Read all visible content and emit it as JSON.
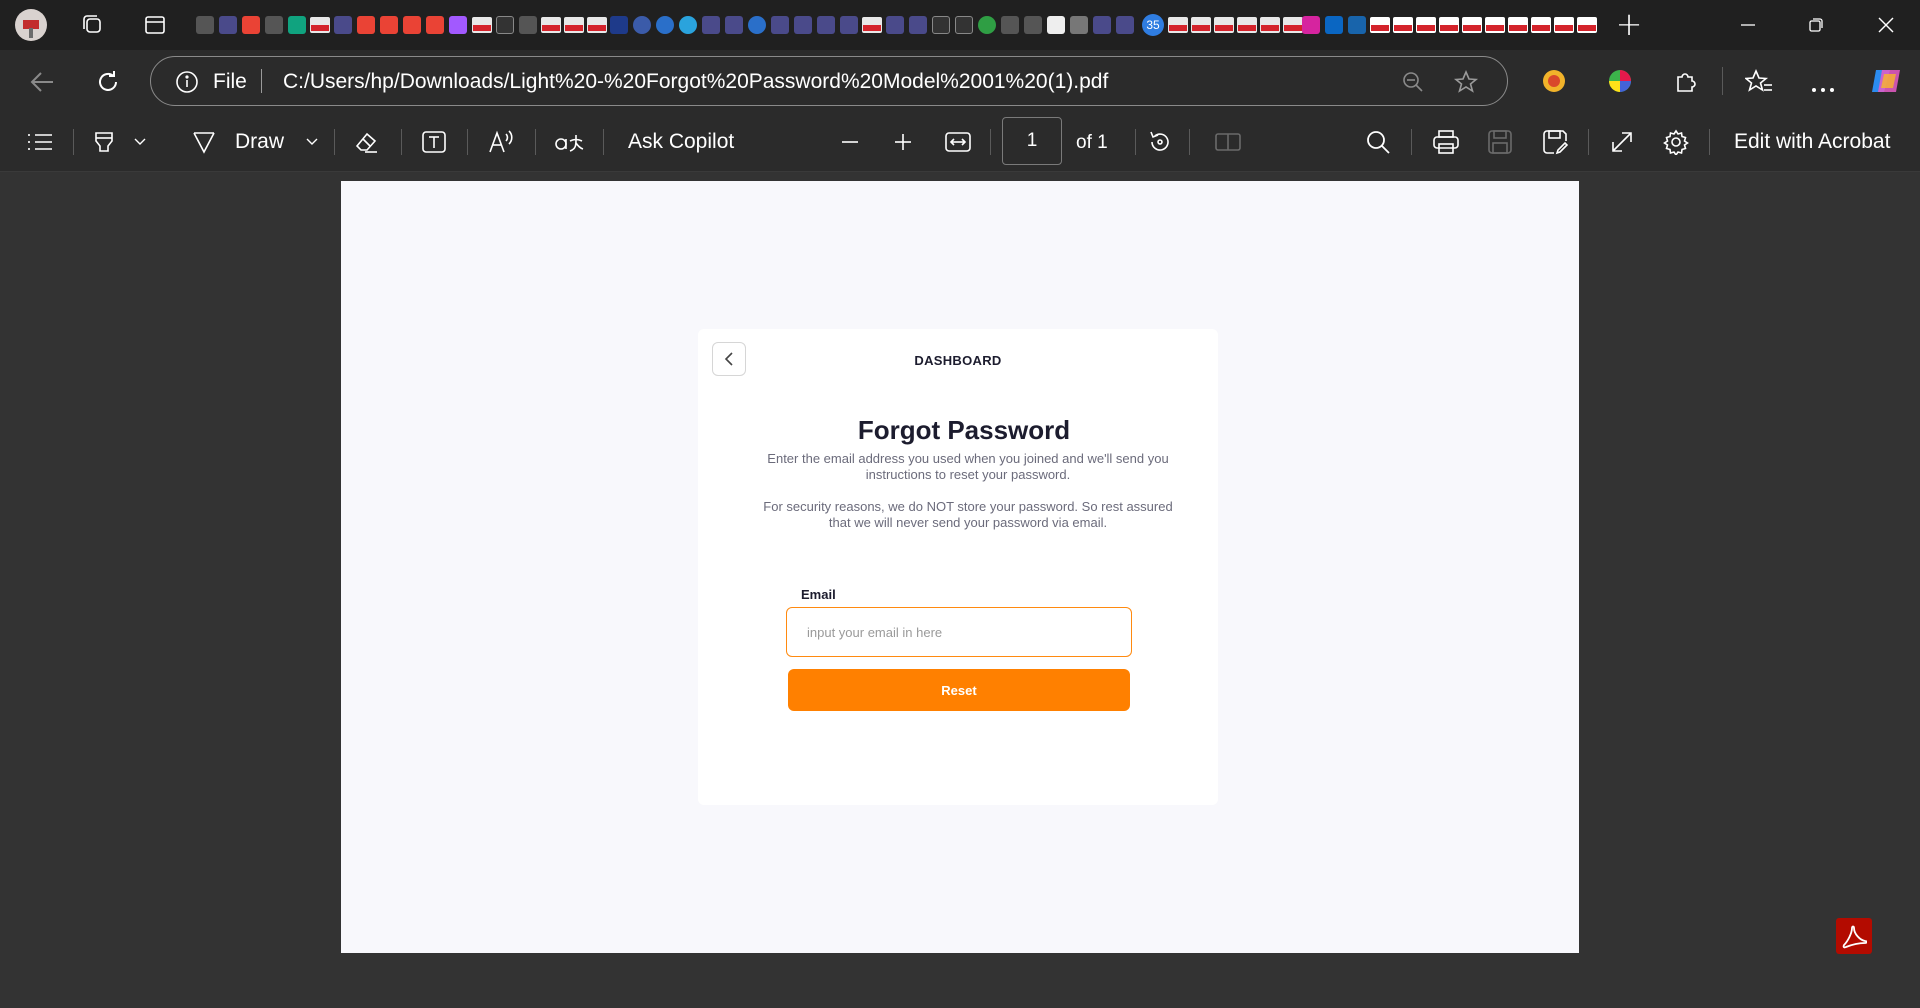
{
  "window": {
    "tab_count_badge": "35",
    "new_tab_symbol": "+",
    "controls": [
      "minimize",
      "restore",
      "close"
    ]
  },
  "address_bar": {
    "scheme_label": "File",
    "url": "C:/Users/hp/Downloads/Light%20-%20Forgot%20Password%20Model%2001%20(1).pdf"
  },
  "pdf_toolbar": {
    "draw_label": "Draw",
    "ask_copilot_label": "Ask Copilot",
    "page_number": "1",
    "page_total": "of 1",
    "edit_label": "Edit with Acrobat"
  },
  "document": {
    "header": "DASHBOARD",
    "title": "Forgot Password",
    "description_1": "Enter the email address you used when you joined and we'll send you instructions to reset your password.",
    "description_2": "For security reasons, we do NOT store your password. So rest assured that we will never send your password via email.",
    "email_label": "Email",
    "email_placeholder": "input your email in here",
    "reset_label": "Reset",
    "accent_color": "#ff8000"
  }
}
